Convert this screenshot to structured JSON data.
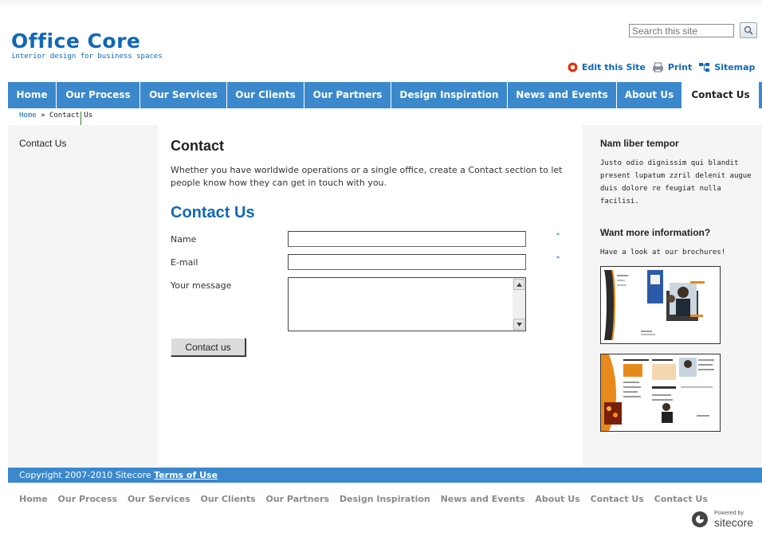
{
  "site": {
    "logo": "Office Core",
    "tagline": "interior design for business spaces"
  },
  "search": {
    "placeholder": "Search this site"
  },
  "tools": {
    "edit": "Edit this Site",
    "print": "Print",
    "sitemap": "Sitemap"
  },
  "nav": {
    "items": [
      {
        "label": "Home"
      },
      {
        "label": "Our Process"
      },
      {
        "label": "Our Services"
      },
      {
        "label": "Our Clients"
      },
      {
        "label": "Our Partners"
      },
      {
        "label": "Design Inspiration"
      },
      {
        "label": "News and Events"
      },
      {
        "label": "About Us"
      },
      {
        "label": "Contact Us"
      }
    ],
    "active": "Contact Us"
  },
  "breadcrumb": {
    "home": "Home",
    "sep": "»",
    "current": "Contact Us"
  },
  "left": {
    "item": "Contact Us"
  },
  "main": {
    "heading": "Contact",
    "intro": "Whether you have worldwide operations or a single office, create a Contact section to let people know how they can get in touch with you.",
    "form_title": "Contact Us",
    "fields": {
      "name": "Name",
      "email": "E-mail",
      "message": "Your message"
    },
    "required_mark": "*",
    "submit": "Contact us"
  },
  "right": {
    "title1": "Nam liber tempor",
    "text1": "Justo odio dignissim qui blandit present lupatum zzril delenit augue duis dolore re feugiat nulla facilisi.",
    "title2": "Want more information?",
    "text2": "Have a look at our brochures!"
  },
  "footer": {
    "copyright": "Copyright  2007-2010  Sitecore",
    "terms": "Terms of Use",
    "links": [
      "Home",
      "Our Process",
      "Our Services",
      "Our Clients",
      "Our Partners",
      "Design Inspiration",
      "News and Events",
      "About Us",
      "Contact Us",
      "Contact Us"
    ],
    "powered_by": "Powered by",
    "brand": "sitecore"
  },
  "colors": {
    "brand_blue": "#1068b8",
    "nav_blue": "#3b88cc",
    "edit_icon_red": "#d93a12",
    "brochure_orange": "#e8891c"
  }
}
